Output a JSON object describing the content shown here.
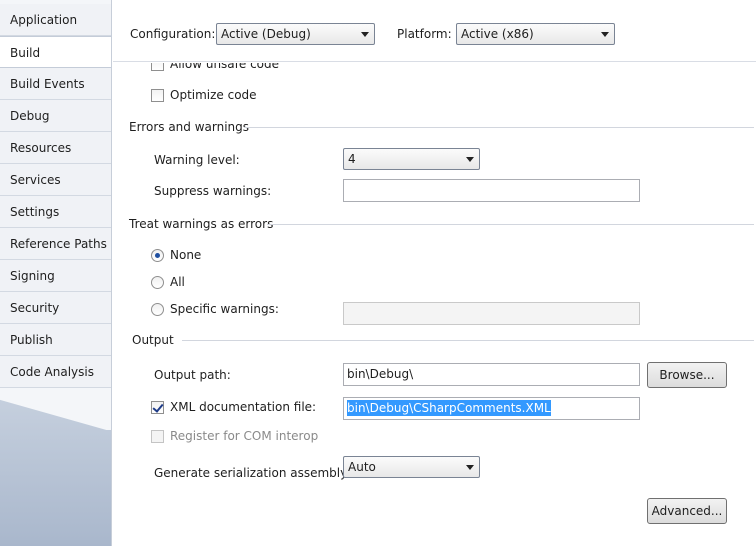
{
  "sidebar": {
    "tabs": [
      {
        "label": "Application"
      },
      {
        "label": "Build"
      },
      {
        "label": "Build Events"
      },
      {
        "label": "Debug"
      },
      {
        "label": "Resources"
      },
      {
        "label": "Services"
      },
      {
        "label": "Settings"
      },
      {
        "label": "Reference Paths"
      },
      {
        "label": "Signing"
      },
      {
        "label": "Security"
      },
      {
        "label": "Publish"
      },
      {
        "label": "Code Analysis"
      }
    ],
    "selected": "Build"
  },
  "toolbar": {
    "configuration_label": "Configuration:",
    "configuration_value": "Active (Debug)",
    "platform_label": "Platform:",
    "platform_value": "Active (x86)"
  },
  "general": {
    "allow_unsafe_label": "Allow unsafe code",
    "optimize_label": "Optimize code"
  },
  "errors": {
    "title": "Errors and warnings",
    "warning_level_label": "Warning level:",
    "warning_level_value": "4",
    "suppress_label": "Suppress warnings:",
    "suppress_value": ""
  },
  "treat": {
    "title": "Treat warnings as errors",
    "none_label": "None",
    "all_label": "All",
    "specific_label": "Specific warnings:",
    "specific_value": ""
  },
  "output": {
    "title": "Output",
    "path_label": "Output path:",
    "path_value": "bin\\Debug\\",
    "browse_label": "Browse...",
    "xml_label": "XML documentation file:",
    "xml_value": "bin\\Debug\\CSharpComments.XML",
    "com_label": "Register for COM interop",
    "serialization_label": "Generate serialization assembly:",
    "serialization_value": "Auto",
    "advanced_label": "Advanced..."
  }
}
